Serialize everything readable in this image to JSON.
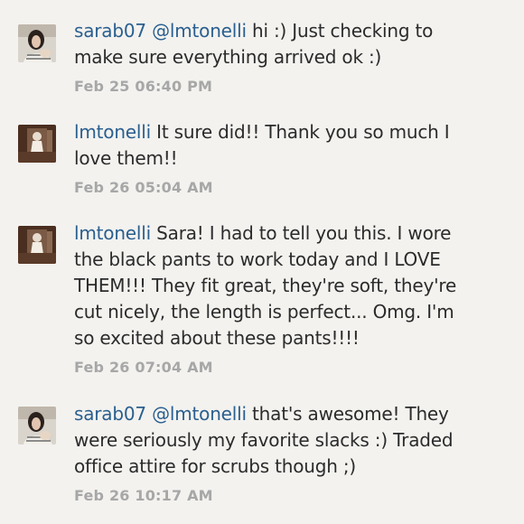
{
  "comments": [
    {
      "username": "sarab07",
      "mention": "@lmtonelli",
      "text": " hi :) Just checking to make sure everything arrived ok :)",
      "timestamp": "Feb 25 06:40 PM",
      "avatar": "user-avatar-sarab07"
    },
    {
      "username": "lmtonelli",
      "mention": "",
      "text": "It sure did!! Thank you so much I love them!!",
      "timestamp": "Feb 26 05:04 AM",
      "avatar": "user-avatar-lmtonelli"
    },
    {
      "username": "lmtonelli",
      "mention": "",
      "text": "Sara! I had to tell you this. I wore the black pants to work today and I LOVE THEM!!! They fit great, they're soft, they're cut nicely, the length is perfect... Omg. I'm so excited about these pants!!!!",
      "timestamp": "Feb 26 07:04 AM",
      "avatar": "user-avatar-lmtonelli"
    },
    {
      "username": "sarab07",
      "mention": "@lmtonelli",
      "text": " that's awesome! They were seriously my favorite slacks :) Traded office attire for scrubs though ;)",
      "timestamp": "Feb 26 10:17 AM",
      "avatar": "user-avatar-sarab07"
    }
  ],
  "colors": {
    "background": "#f3f2ef",
    "username": "#2a5f8f",
    "text": "#2b2b2b",
    "timestamp": "#a7a7a7"
  }
}
